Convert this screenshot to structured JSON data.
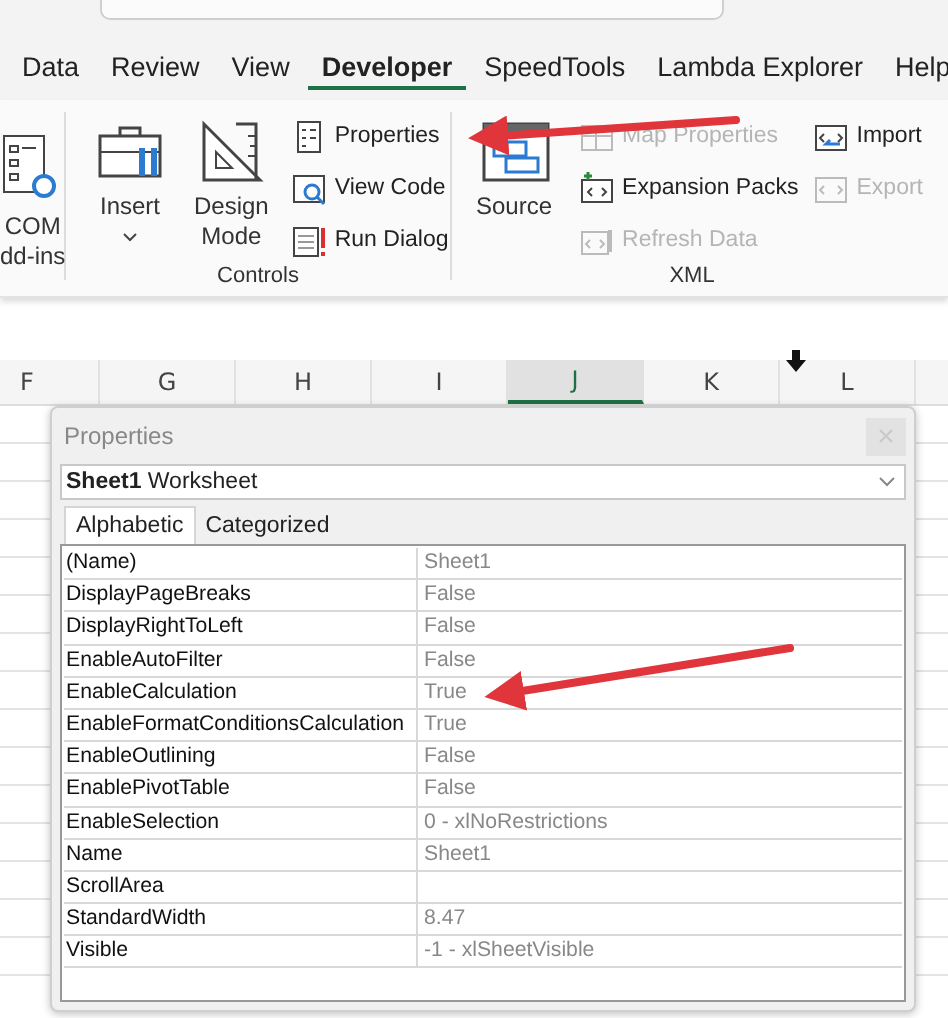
{
  "ribbon_tabs": [
    {
      "label": "Data",
      "selected": false
    },
    {
      "label": "Review",
      "selected": false
    },
    {
      "label": "View",
      "selected": false
    },
    {
      "label": "Developer",
      "selected": true
    },
    {
      "label": "SpeedTools",
      "selected": false
    },
    {
      "label": "Lambda Explorer",
      "selected": false
    },
    {
      "label": "Help",
      "selected": false
    }
  ],
  "com_addins": {
    "lines": [
      "COM",
      "dd-ins"
    ]
  },
  "controls_group": {
    "label": "Controls",
    "large_buttons": [
      {
        "kind": "insert",
        "lines": [
          "Insert"
        ],
        "dropdown": true
      },
      {
        "kind": "design",
        "lines": [
          "Design",
          "Mode"
        ],
        "dropdown": false
      }
    ],
    "small_buttons": [
      {
        "label": "Properties",
        "disabled": false
      },
      {
        "label": "View Code",
        "disabled": false
      },
      {
        "label": "Run Dialog",
        "disabled": false
      }
    ]
  },
  "xml_group": {
    "label": "XML",
    "large_buttons": [
      {
        "kind": "source",
        "lines": [
          "Source"
        ],
        "dropdown": false
      }
    ],
    "small_buttons": [
      {
        "label": "Map Properties",
        "disabled": true
      },
      {
        "label": "Expansion Packs",
        "disabled": false
      },
      {
        "label": "Refresh Data",
        "disabled": true
      },
      {
        "label": "Import",
        "disabled": false
      },
      {
        "label": "Export",
        "disabled": true
      }
    ]
  },
  "columns": [
    {
      "label": "F",
      "selected": false
    },
    {
      "label": "G",
      "selected": false
    },
    {
      "label": "H",
      "selected": false
    },
    {
      "label": "I",
      "selected": false
    },
    {
      "label": "J",
      "selected": true
    },
    {
      "label": "K",
      "selected": false
    },
    {
      "label": "L",
      "selected": false
    }
  ],
  "properties_window": {
    "title": "Properties",
    "object_selector": "**Sheet1** Worksheet",
    "tabs": [
      {
        "label": "Alphabetic",
        "selected": true
      },
      {
        "label": "Categorized",
        "selected": false
      }
    ],
    "rows": [
      {
        "name": "(Name)",
        "value": "Sheet1"
      },
      {
        "name": "DisplayPageBreaks",
        "value": "False"
      },
      {
        "name": "DisplayRightToLeft",
        "value": "False"
      },
      {
        "name": "EnableAutoFilter",
        "value": "False"
      },
      {
        "name": "EnableCalculation",
        "value": "True"
      },
      {
        "name": "EnableFormatConditionsCalculation",
        "value": "True"
      },
      {
        "name": "EnableOutlining",
        "value": "False"
      },
      {
        "name": "EnablePivotTable",
        "value": "False"
      },
      {
        "name": "EnableSelection",
        "value": "0 - xlNoRestrictions"
      },
      {
        "name": "Name",
        "value": "Sheet1"
      },
      {
        "name": "ScrollArea"
      },
      {
        "name": "StandardWidth",
        "value": "8.47"
      },
      {
        "name": "Visible",
        "value": "-1 - xlSheetVisible"
      }
    ]
  }
}
